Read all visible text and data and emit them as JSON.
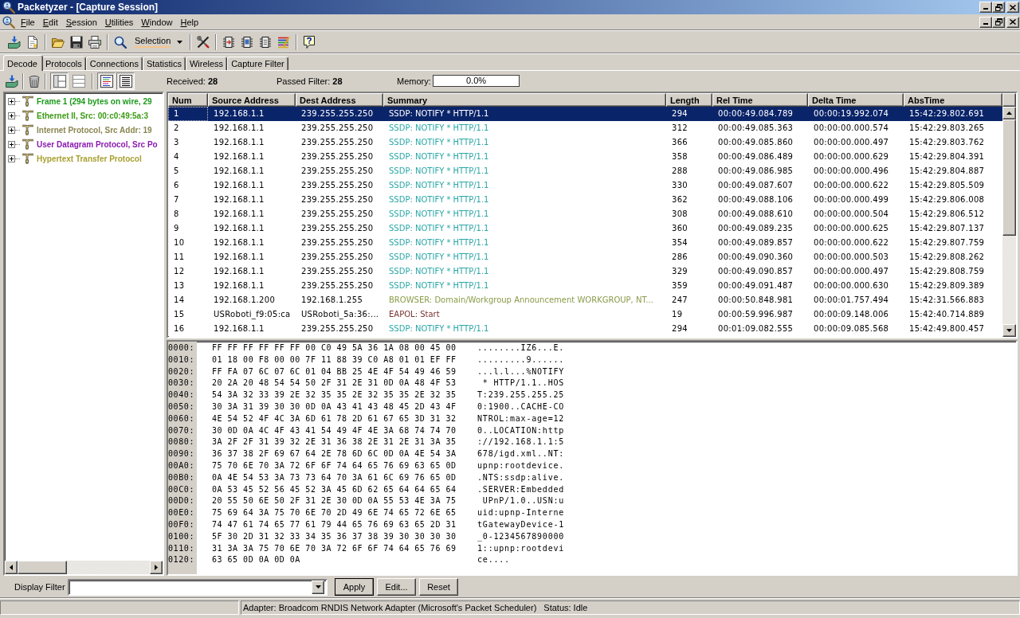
{
  "window": {
    "title": "Packetyzer - [Capture Session]"
  },
  "menu": [
    "File",
    "Edit",
    "Session",
    "Utilities",
    "Window",
    "Help"
  ],
  "toolbar": {
    "selection": "Selection"
  },
  "tabs": [
    {
      "label": "Decode",
      "selected": true
    },
    {
      "label": "Protocols",
      "selected": false
    },
    {
      "label": "Connections",
      "selected": false
    },
    {
      "label": "Statistics",
      "selected": false
    },
    {
      "label": "Wireless",
      "selected": false
    },
    {
      "label": "Capture Filter",
      "selected": false
    }
  ],
  "decode_bar": {
    "view_toggles": [
      {
        "on": true
      },
      {
        "on": false
      },
      {
        "on": true
      },
      {
        "on": true
      }
    ],
    "received": "Received: **28**",
    "passed_filter": "Passed Filter: **28**",
    "memory_label": "Memory:",
    "memory": {
      "level": 0,
      "reading": "0.0%"
    }
  },
  "protocol_tree": [
    {
      "label": "Frame 1 (294 bytes on wire, 29",
      "color": "#1c9a1c",
      "expanded": false
    },
    {
      "label": "Ethernet II, Src: 00:c0:49:5a:3",
      "color": "#3c9a14",
      "expanded": false
    },
    {
      "label": "Internet Protocol, Src Addr: 19",
      "color": "#8a8650",
      "expanded": false
    },
    {
      "label": "User Datagram Protocol, Src Po",
      "color": "#8a1ab0",
      "expanded": false
    },
    {
      "label": "Hypertext Transfer Protocol",
      "color": "#a8a030",
      "expanded": false
    }
  ],
  "packet_list": {
    "columns": [
      "Num",
      "Source Address",
      "Dest Address",
      "Summary",
      "Length",
      "Rel Time",
      "Delta Time",
      "AbsTime"
    ],
    "rows": [
      {
        "num": "1",
        "source": "192.168.1.1",
        "dest": "239.255.255.250",
        "summary": "SSDP: NOTIFY * HTTP/1.1",
        "length": "294",
        "rel_time": "00:00:49.084.789",
        "delta_time": "00:00:19.992.074",
        "abs_time": "15:42:29.802.691",
        "selected": true
      },
      {
        "num": "2",
        "source": "192.168.1.1",
        "dest": "239.255.255.250",
        "summary": "SSDP: NOTIFY * HTTP/1.1",
        "color": "#2aa6a6",
        "length": "312",
        "rel_time": "00:00:49.085.363",
        "delta_time": "00:00:00.000.574",
        "abs_time": "15:42:29.803.265",
        "selected": false
      },
      {
        "num": "3",
        "source": "192.168.1.1",
        "dest": "239.255.255.250",
        "summary": "SSDP: NOTIFY * HTTP/1.1",
        "color": "#2aa6a6",
        "length": "366",
        "rel_time": "00:00:49.085.860",
        "delta_time": "00:00:00.000.497",
        "abs_time": "15:42:29.803.762",
        "selected": false
      },
      {
        "num": "4",
        "source": "192.168.1.1",
        "dest": "239.255.255.250",
        "summary": "SSDP: NOTIFY * HTTP/1.1",
        "color": "#2aa6a6",
        "length": "358",
        "rel_time": "00:00:49.086.489",
        "delta_time": "00:00:00.000.629",
        "abs_time": "15:42:29.804.391",
        "selected": false
      },
      {
        "num": "5",
        "source": "192.168.1.1",
        "dest": "239.255.255.250",
        "summary": "SSDP: NOTIFY * HTTP/1.1",
        "color": "#2aa6a6",
        "length": "288",
        "rel_time": "00:00:49.086.985",
        "delta_time": "00:00:00.000.496",
        "abs_time": "15:42:29.804.887",
        "selected": false
      },
      {
        "num": "6",
        "source": "192.168.1.1",
        "dest": "239.255.255.250",
        "summary": "SSDP: NOTIFY * HTTP/1.1",
        "color": "#2aa6a6",
        "length": "330",
        "rel_time": "00:00:49.087.607",
        "delta_time": "00:00:00.000.622",
        "abs_time": "15:42:29.805.509",
        "selected": false
      },
      {
        "num": "7",
        "source": "192.168.1.1",
        "dest": "239.255.255.250",
        "summary": "SSDP: NOTIFY * HTTP/1.1",
        "color": "#2aa6a6",
        "length": "362",
        "rel_time": "00:00:49.088.106",
        "delta_time": "00:00:00.000.499",
        "abs_time": "15:42:29.806.008",
        "selected": false
      },
      {
        "num": "8",
        "source": "192.168.1.1",
        "dest": "239.255.255.250",
        "summary": "SSDP: NOTIFY * HTTP/1.1",
        "color": "#2aa6a6",
        "length": "308",
        "rel_time": "00:00:49.088.610",
        "delta_time": "00:00:00.000.504",
        "abs_time": "15:42:29.806.512",
        "selected": false
      },
      {
        "num": "9",
        "source": "192.168.1.1",
        "dest": "239.255.255.250",
        "summary": "SSDP: NOTIFY * HTTP/1.1",
        "color": "#2aa6a6",
        "length": "360",
        "rel_time": "00:00:49.089.235",
        "delta_time": "00:00:00.000.625",
        "abs_time": "15:42:29.807.137",
        "selected": false
      },
      {
        "num": "10",
        "source": "192.168.1.1",
        "dest": "239.255.255.250",
        "summary": "SSDP: NOTIFY * HTTP/1.1",
        "color": "#2aa6a6",
        "length": "354",
        "rel_time": "00:00:49.089.857",
        "delta_time": "00:00:00.000.622",
        "abs_time": "15:42:29.807.759",
        "selected": false
      },
      {
        "num": "11",
        "source": "192.168.1.1",
        "dest": "239.255.255.250",
        "summary": "SSDP: NOTIFY * HTTP/1.1",
        "color": "#2aa6a6",
        "length": "286",
        "rel_time": "00:00:49.090.360",
        "delta_time": "00:00:00.000.503",
        "abs_time": "15:42:29.808.262",
        "selected": false
      },
      {
        "num": "12",
        "source": "192.168.1.1",
        "dest": "239.255.255.250",
        "summary": "SSDP: NOTIFY * HTTP/1.1",
        "color": "#2aa6a6",
        "length": "329",
        "rel_time": "00:00:49.090.857",
        "delta_time": "00:00:00.000.497",
        "abs_time": "15:42:29.808.759",
        "selected": false
      },
      {
        "num": "13",
        "source": "192.168.1.1",
        "dest": "239.255.255.250",
        "summary": "SSDP: NOTIFY * HTTP/1.1",
        "color": "#2aa6a6",
        "length": "359",
        "rel_time": "00:00:49.091.487",
        "delta_time": "00:00:00.000.630",
        "abs_time": "15:42:29.809.389",
        "selected": false
      },
      {
        "num": "14",
        "source": "192.168.1.200",
        "dest": "192.168.1.255",
        "summary": "BROWSER: Domain/Workgroup Announcement WORKGROUP, NT...",
        "color": "#8a9a48",
        "length": "247",
        "rel_time": "00:00:50.848.981",
        "delta_time": "00:00:01.757.494",
        "abs_time": "15:42:31.566.883",
        "selected": false
      },
      {
        "num": "15",
        "source": "USRoboti_f9:05:ca",
        "dest": "USRoboti_5a:36:...",
        "summary": "EAPOL: Start",
        "color": "#7a3434",
        "length": "19",
        "rel_time": "00:00:59.996.987",
        "delta_time": "00:00:09.148.006",
        "abs_time": "15:42:40.714.889",
        "selected": false
      },
      {
        "num": "16",
        "source": "192.168.1.1",
        "dest": "239.255.255.250",
        "summary": "SSDP: NOTIFY * HTTP/1.1",
        "color": "#2aa6a6",
        "length": "294",
        "rel_time": "00:01:09.082.555",
        "delta_time": "00:00:09.085.568",
        "abs_time": "15:42:49.800.457",
        "selected": false
      }
    ]
  },
  "hex_dump": [
    {
      "offset": "0000:",
      "bytes": "FF FF FF FF FF FF 00 C0 49 5A 36 1A 08 00 45 00",
      "ascii": "........IZ6...E."
    },
    {
      "offset": "0010:",
      "bytes": "01 18 00 F8 00 00 7F 11 88 39 C0 A8 01 01 EF FF",
      "ascii": ".........9......"
    },
    {
      "offset": "0020:",
      "bytes": "FF FA 07 6C 07 6C 01 04 BB 25 4E 4F 54 49 46 59",
      "ascii": "...l.l...%NOTIFY"
    },
    {
      "offset": "0030:",
      "bytes": "20 2A 20 48 54 54 50 2F 31 2E 31 0D 0A 48 4F 53",
      "ascii": " * HTTP/1.1..HOS"
    },
    {
      "offset": "0040:",
      "bytes": "54 3A 32 33 39 2E 32 35 35 2E 32 35 35 2E 32 35",
      "ascii": "T:239.255.255.25"
    },
    {
      "offset": "0050:",
      "bytes": "30 3A 31 39 30 30 0D 0A 43 41 43 48 45 2D 43 4F",
      "ascii": "0:1900..CACHE-CO"
    },
    {
      "offset": "0060:",
      "bytes": "4E 54 52 4F 4C 3A 6D 61 78 2D 61 67 65 3D 31 32",
      "ascii": "NTROL:max-age=12"
    },
    {
      "offset": "0070:",
      "bytes": "30 0D 0A 4C 4F 43 41 54 49 4F 4E 3A 68 74 74 70",
      "ascii": "0..LOCATION:http"
    },
    {
      "offset": "0080:",
      "bytes": "3A 2F 2F 31 39 32 2E 31 36 38 2E 31 2E 31 3A 35",
      "ascii": "://192.168.1.1:5"
    },
    {
      "offset": "0090:",
      "bytes": "36 37 38 2F 69 67 64 2E 78 6D 6C 0D 0A 4E 54 3A",
      "ascii": "678/igd.xml..NT:"
    },
    {
      "offset": "00A0:",
      "bytes": "75 70 6E 70 3A 72 6F 6F 74 64 65 76 69 63 65 0D",
      "ascii": "upnp:rootdevice."
    },
    {
      "offset": "00B0:",
      "bytes": "0A 4E 54 53 3A 73 73 64 70 3A 61 6C 69 76 65 0D",
      "ascii": ".NTS:ssdp:alive."
    },
    {
      "offset": "00C0:",
      "bytes": "0A 53 45 52 56 45 52 3A 45 6D 62 65 64 64 65 64",
      "ascii": ".SERVER:Embedded"
    },
    {
      "offset": "00D0:",
      "bytes": "20 55 50 6E 50 2F 31 2E 30 0D 0A 55 53 4E 3A 75",
      "ascii": " UPnP/1.0..USN:u"
    },
    {
      "offset": "00E0:",
      "bytes": "75 69 64 3A 75 70 6E 70 2D 49 6E 74 65 72 6E 65",
      "ascii": "uid:upnp-Interne"
    },
    {
      "offset": "00F0:",
      "bytes": "74 47 61 74 65 77 61 79 44 65 76 69 63 65 2D 31",
      "ascii": "tGatewayDevice-1"
    },
    {
      "offset": "0100:",
      "bytes": "5F 30 2D 31 32 33 34 35 36 37 38 39 30 30 30 30",
      "ascii": "_0-1234567890000"
    },
    {
      "offset": "0110:",
      "bytes": "31 3A 3A 75 70 6E 70 3A 72 6F 6F 74 64 65 76 69",
      "ascii": "1::upnp:rootdevi"
    },
    {
      "offset": "0120:",
      "bytes": "63 65 0D 0A 0D 0A",
      "ascii": "ce...."
    }
  ],
  "display_filter": {
    "label": "Display Filter",
    "buttons": [
      "Apply",
      "Edit...",
      "Reset"
    ]
  },
  "status_bar": {
    "adapter": "Adapter: Broadcom RNDIS Network Adapter (Microsoft's Packet Scheduler)",
    "status": "Status: Idle"
  }
}
